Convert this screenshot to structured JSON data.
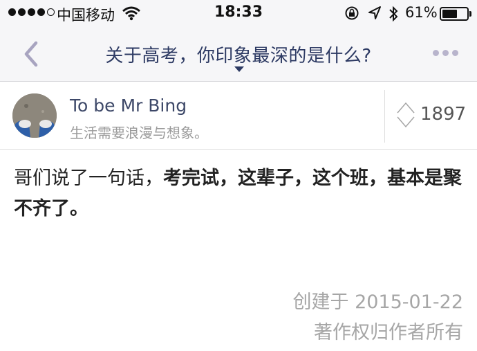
{
  "status_bar": {
    "carrier": "中国移动",
    "time": "18:33",
    "battery_percent": "61%",
    "battery_level": 0.61
  },
  "nav": {
    "title": "关于高考，你印象最深的是什么?"
  },
  "author": {
    "name": "To be Mr Bing",
    "bio": "生活需要浪漫与想象。"
  },
  "vote": {
    "count": "1897"
  },
  "answer": {
    "segments": [
      {
        "text": "哥们说了一句话，",
        "bold": false
      },
      {
        "text": "考完试，这辈子，这个班，基本是聚不齐了。",
        "bold": true
      }
    ]
  },
  "meta": {
    "created": "创建于 2015-01-22",
    "copyright": "著作权归作者所有"
  },
  "colors": {
    "title": "#2d3a63",
    "accent": "#b8b4cc",
    "muted": "#a6a6a6"
  }
}
